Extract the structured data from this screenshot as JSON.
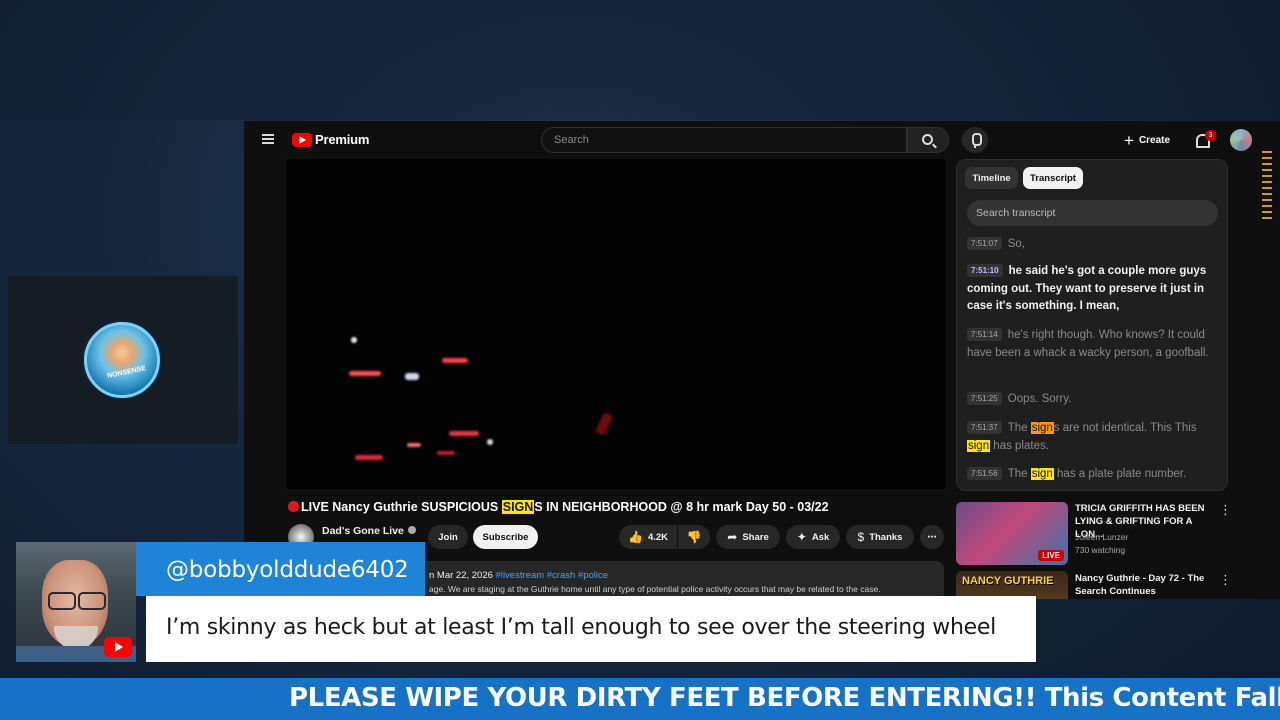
{
  "header": {
    "logo_text": "Premium",
    "search_placeholder": "Search",
    "create_label": "Create",
    "notification_count": "3"
  },
  "video": {
    "title_prefix": "LIVE Nancy Guthrie SUSPICIOUS ",
    "title_highlight": "SIGN",
    "title_suffix": "S IN NEIGHBORHOOD @ 8 hr mark Day 50 - 03/22",
    "channel_name": "Dad's Gone Live",
    "join_label": "Join",
    "subscribe_label": "Subscribe",
    "like_count": "4.2K",
    "share_label": "Share",
    "ask_label": "Ask",
    "thanks_label": "Thanks",
    "description_date": "n Mar 22, 2026",
    "description_tags": "#livestream #crash #police",
    "description_text": "age. We are staging at the Guthrie home until any type of potential police activity occurs that may be related to the case."
  },
  "transcript": {
    "tab_timeline": "Timeline",
    "tab_transcript": "Transcript",
    "search_placeholder": "Search transcript",
    "segments": [
      {
        "time": "7:51:07",
        "text": "So,"
      },
      {
        "time": "7:51:10",
        "text": "he said he's got a couple more guys coming out. They want to preserve it just in case it's something. I mean,"
      },
      {
        "time": "7:51:14",
        "text": "he's right though. Who knows? It could have been a whack a wacky person, a goofball."
      },
      {
        "time": "7:51:25",
        "text": "Oops. Sorry."
      },
      {
        "time": "7:51:37",
        "text_a": "The ",
        "hl_a": "sign",
        "text_b": "s are not identical. This This ",
        "hl_b": "sign",
        "text_c": " has plates."
      },
      {
        "time": "7:51:56",
        "text_a": "The ",
        "hl_a": "sign",
        "text_b": " has a plate plate number."
      }
    ]
  },
  "recommended": [
    {
      "title": "TRICIA GRIFFITH HAS BEEN LYING & GRIFTING FOR A LON...",
      "channel": "Joleen Lunzer",
      "meta": "730 watching",
      "thumb_badge": "LIVE"
    },
    {
      "title": "Nancy Guthrie - Day 72 - The Search Continues",
      "thumb_text": "NANCY GUTHRIE"
    }
  ],
  "chat": {
    "username": "@bobbyolddude6402",
    "message": "I’m skinny as heck but at least I’m tall enough to see over the steering wheel"
  },
  "ticker": {
    "text": "PLEASE WIPE YOUR DIRTY FEET BEFORE ENTERING!! This Content Falls under th"
  },
  "colors": {
    "accent_red": "#ff0000",
    "chat_name_bg": "#1f84d8",
    "ticker_bg": "#1672c6",
    "highlight_yellow": "#ffe600",
    "highlight_orange": "#ff9900"
  }
}
